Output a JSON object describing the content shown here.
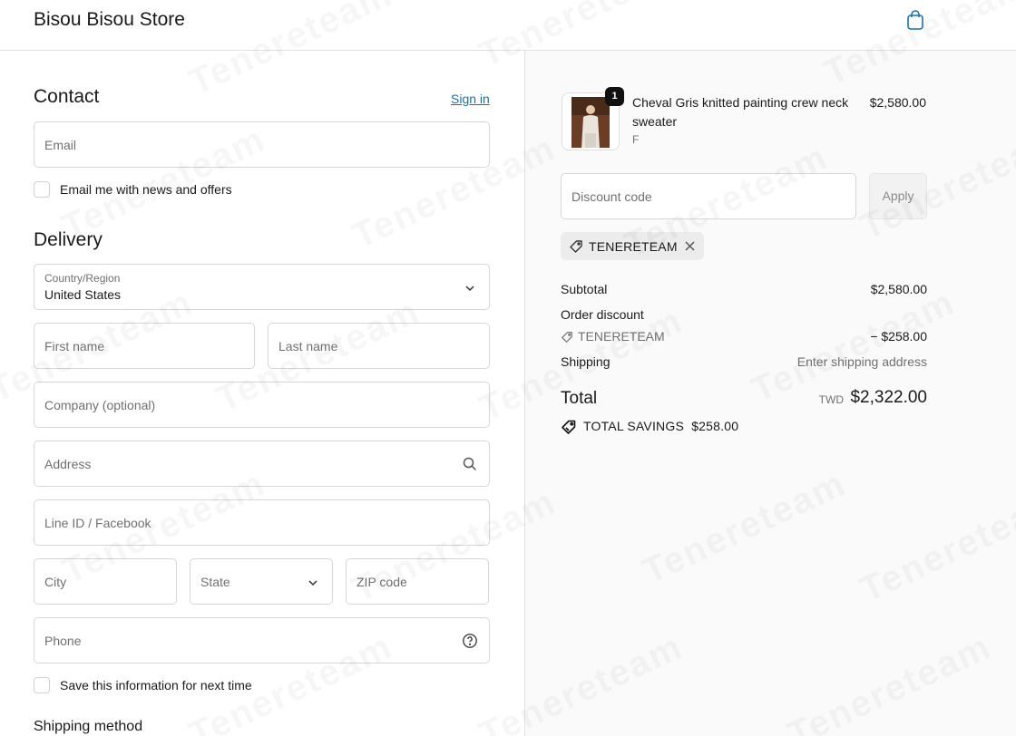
{
  "header": {
    "store_name": "Bisou Bisou Store",
    "cart_icon": "shopping-bag-icon"
  },
  "watermark": {
    "text": "Tenereteam"
  },
  "contact": {
    "title": "Contact",
    "sign_in_label": "Sign in",
    "email_placeholder": "Email",
    "newsletter_label": "Email me with news and offers",
    "newsletter_checked": false
  },
  "delivery": {
    "title": "Delivery",
    "country_label": "Country/Region",
    "country_value": "United States",
    "first_name_placeholder": "First name",
    "last_name_placeholder": "Last name",
    "company_placeholder": "Company (optional)",
    "address_placeholder": "Address",
    "line_placeholder": "Line ID / Facebook",
    "city_placeholder": "City",
    "state_placeholder": "State",
    "zip_placeholder": "ZIP code",
    "phone_placeholder": "Phone",
    "save_info_label": "Save this information for next time",
    "save_info_checked": false
  },
  "shipping_method": {
    "title": "Shipping method"
  },
  "summary": {
    "product": {
      "name": "Cheval Gris knitted painting crew neck sweater",
      "variant": "F",
      "quantity": "1",
      "price": "$2,580.00"
    },
    "discount_placeholder": "Discount code",
    "apply_label": "Apply",
    "applied_code": "TENERETEAM",
    "subtotal_label": "Subtotal",
    "subtotal_value": "$2,580.00",
    "order_discount_label": "Order discount",
    "order_discount_code": "TENERETEAM",
    "order_discount_value": "− $258.00",
    "shipping_label": "Shipping",
    "shipping_value": "Enter shipping address",
    "total_label": "Total",
    "currency": "TWD",
    "total_value": "$2,322.00",
    "savings_label": "TOTAL SAVINGS",
    "savings_value": "$258.00"
  }
}
